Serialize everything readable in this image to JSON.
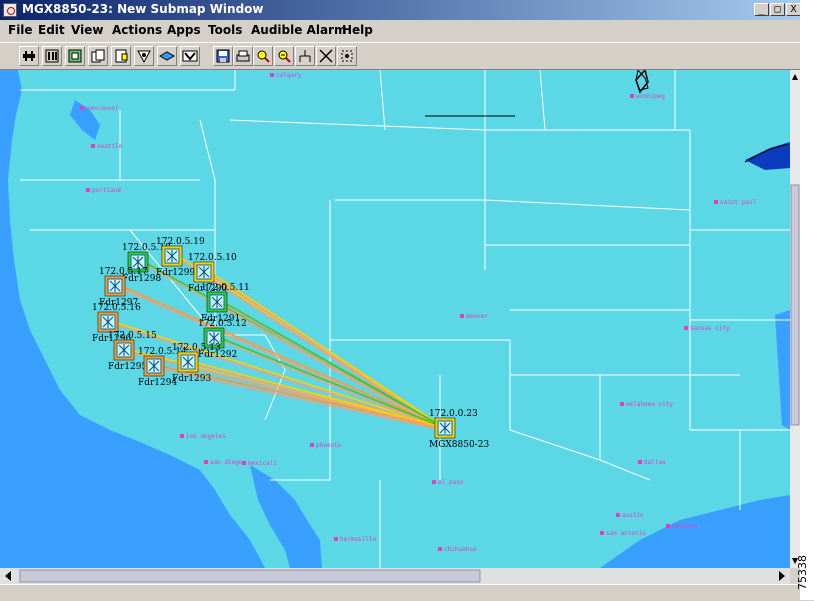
{
  "window": {
    "title": "MGX8850-23: New Submap Window",
    "controls": {
      "minimize": "_",
      "maximize": "□",
      "close": "X"
    }
  },
  "menu": {
    "items": [
      {
        "label": "File"
      },
      {
        "label": "Edit"
      },
      {
        "label": "View"
      },
      {
        "label": "Actions"
      },
      {
        "label": "Apps"
      },
      {
        "label": "Tools"
      },
      {
        "label": "Audible Alarm"
      },
      {
        "label": "Help"
      }
    ]
  },
  "toolbar": {
    "buttons": [
      {
        "icon": "network-icon"
      },
      {
        "icon": "shelf-icon"
      },
      {
        "icon": "card-icon"
      },
      {
        "icon": "copy-icon"
      },
      {
        "icon": "configure-icon"
      },
      {
        "icon": "diagnostics-icon"
      },
      {
        "icon": "layer-icon"
      },
      {
        "icon": "alarm-icon"
      },
      {
        "icon": "save-icon"
      },
      {
        "icon": "print-icon"
      },
      {
        "icon": "zoom-in-icon"
      },
      {
        "icon": "zoom-out-icon"
      },
      {
        "icon": "tree-icon"
      },
      {
        "icon": "fit-icon"
      },
      {
        "icon": "select-all-icon"
      }
    ]
  },
  "map": {
    "colors": {
      "land": "#5bd7e6",
      "water": "#3aa0ff",
      "borders": "#ffffff",
      "city": "#e040c0"
    },
    "hub": {
      "ip": "172.0.0.23",
      "name": "MGX8850-23",
      "status_color": "#ffd000"
    },
    "nodes": [
      {
        "ip": "172.0.5.18",
        "name": "Fdr1298",
        "status_color": "#33cc33"
      },
      {
        "ip": "172.0.5.19",
        "name": "Fdr1299",
        "status_color": "#ffd000"
      },
      {
        "ip": "172.0.5.10",
        "name": "Fdr1290",
        "status_color": "#ffd000"
      },
      {
        "ip": "172.0.5.17",
        "name": "Fdr1297",
        "status_color": "#ff9933"
      },
      {
        "ip": "172.0.5.11",
        "name": "Fdr1291",
        "status_color": "#33cc33"
      },
      {
        "ip": "172.0.5.16",
        "name": "Fdr1296",
        "status_color": "#ff9933"
      },
      {
        "ip": "172.0.5.12",
        "name": "Fdr1292",
        "status_color": "#33cc33"
      },
      {
        "ip": "172.0.5.15",
        "name": "Fdr1295",
        "status_color": "#ff9933"
      },
      {
        "ip": "172.0.5.14",
        "name": "Fdr1294",
        "status_color": "#ff9933"
      },
      {
        "ip": "172.0.5.13",
        "name": "Fdr1293",
        "status_color": "#ffd000"
      }
    ],
    "cities": [
      "calgary",
      "winnipeg",
      "vancouver",
      "seattle",
      "portland",
      "denver",
      "kansas city",
      "saint paul",
      "oklahoma city",
      "los angeles",
      "san diego",
      "phoenix",
      "el paso",
      "dallas",
      "austin",
      "houston",
      "san antonio",
      "chihuahua",
      "hermosillo",
      "mexicali"
    ]
  },
  "figure_id": "75338"
}
